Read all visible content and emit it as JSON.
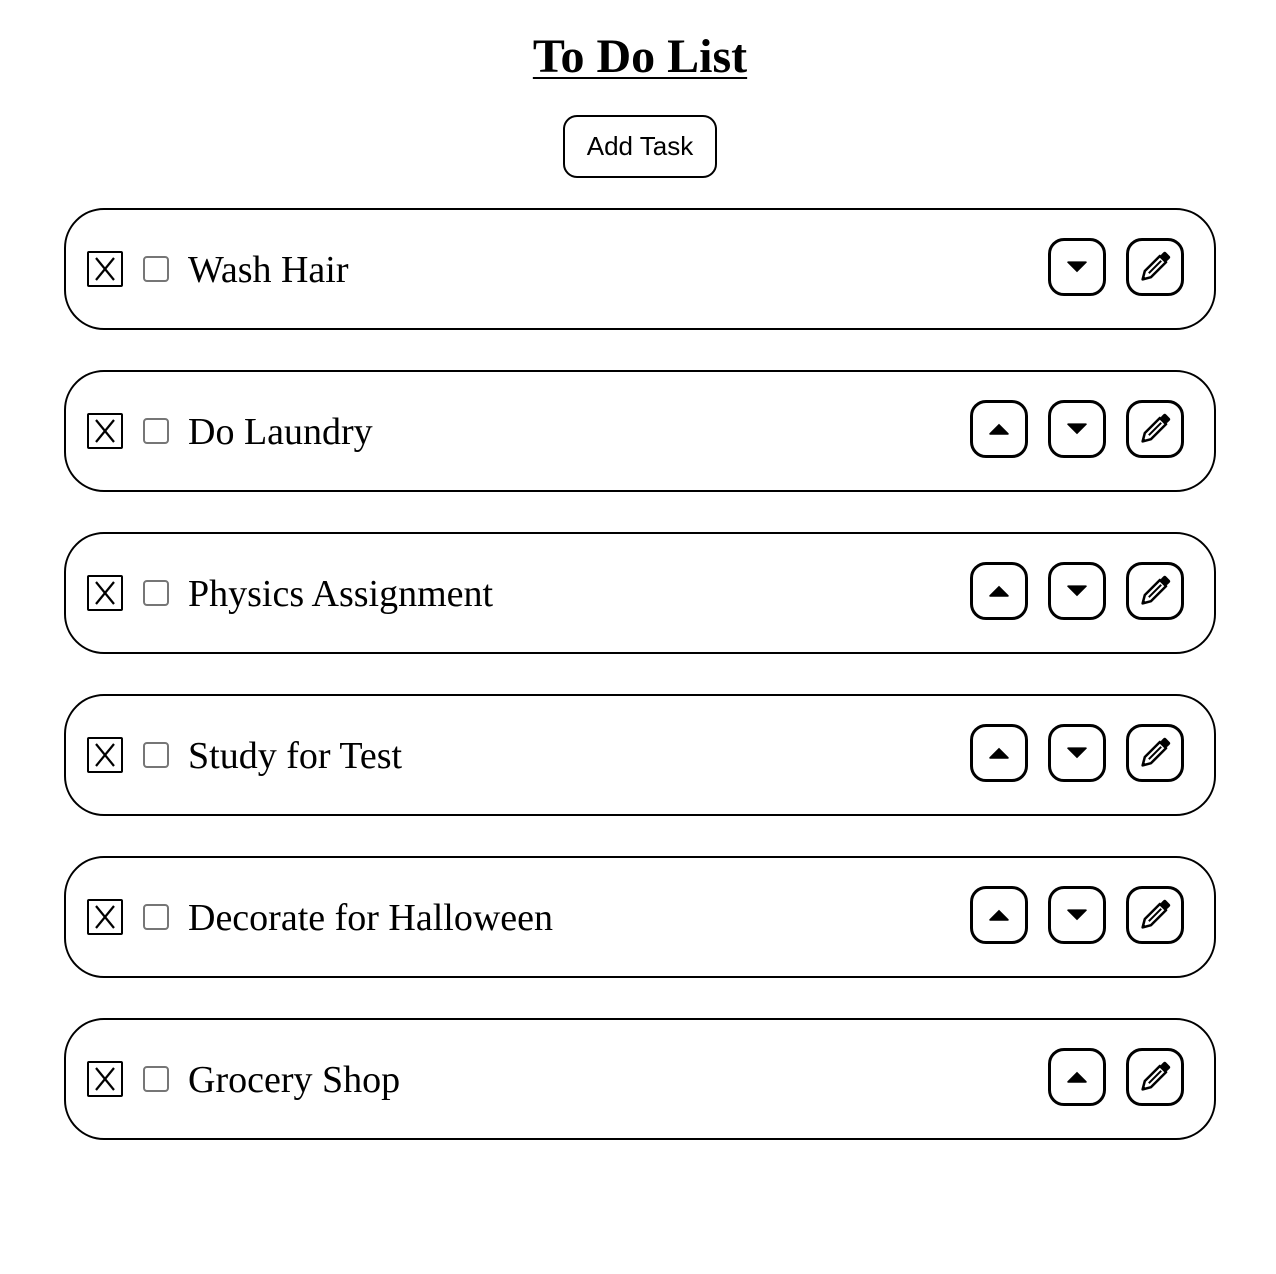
{
  "page": {
    "title": "To Do List",
    "add_task_label": "Add Task"
  },
  "tasks": [
    {
      "label": "Wash Hair",
      "has_up": false,
      "has_down": true,
      "done": false
    },
    {
      "label": "Do Laundry",
      "has_up": true,
      "has_down": true,
      "done": false
    },
    {
      "label": "Physics Assignment",
      "has_up": true,
      "has_down": true,
      "done": false
    },
    {
      "label": "Study for Test",
      "has_up": true,
      "has_down": true,
      "done": false
    },
    {
      "label": "Decorate for Halloween",
      "has_up": true,
      "has_down": true,
      "done": false
    },
    {
      "label": "Grocery Shop",
      "has_up": true,
      "has_down": false,
      "done": false
    }
  ],
  "icons": {
    "delete": "close-icon",
    "move_up": "caret-up-icon",
    "move_down": "caret-down-icon",
    "edit": "pencil-icon"
  }
}
